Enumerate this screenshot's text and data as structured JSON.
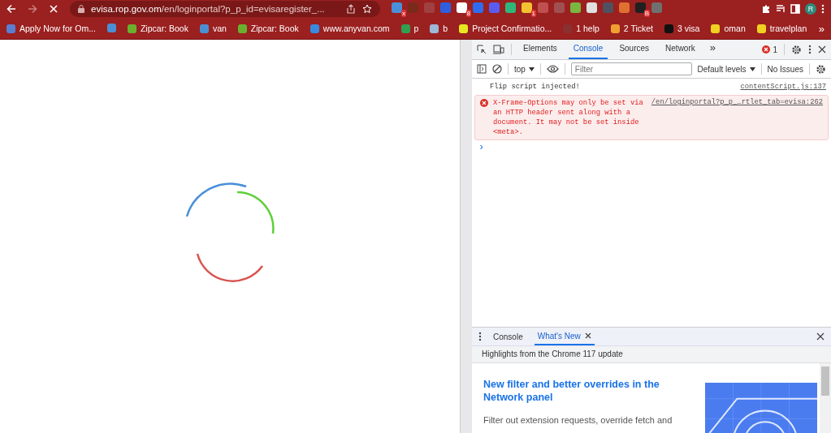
{
  "browser": {
    "url_host": "evisa.rop.gov.om",
    "url_path": "/en/loginportal?p_p_id=evisaregister_...",
    "loading": true,
    "extensions": [
      {
        "color": "#4a90d9",
        "badge": "x"
      },
      {
        "color": "#7a2a1a"
      },
      {
        "color": "#a04040"
      },
      {
        "color": "#2f5fe0"
      },
      {
        "color": "#ffffff",
        "badge": "8"
      },
      {
        "color": "#2f6cf0"
      },
      {
        "color": "#5a5cf0"
      },
      {
        "color": "#2fb67a"
      },
      {
        "color": "#f2c230",
        "badge": "1"
      },
      {
        "color": "#c05050"
      },
      {
        "color": "#a05050"
      },
      {
        "color": "#7ab640"
      },
      {
        "color": "#e0e0e0"
      },
      {
        "color": "#505060"
      },
      {
        "color": "#e07030"
      },
      {
        "color": "#202020",
        "badge": "B"
      },
      {
        "color": "#707070"
      }
    ],
    "avatar": "R",
    "bookmarks": [
      {
        "label": "Apply Now for Om...",
        "color": "#5b7fd0"
      },
      {
        "color": "#4a8fd4"
      },
      {
        "label": "Zipcar: Book",
        "color": "#6ab02e"
      },
      {
        "label": "van",
        "color": "#4a8fd4"
      },
      {
        "label": "Zipcar: Book",
        "color": "#6ab02e"
      },
      {
        "label": "www.anyvan.com",
        "color": "#3a8be0"
      },
      {
        "label": "p",
        "color": "#30a050"
      },
      {
        "label": "b",
        "color": "#a0b8d8"
      },
      {
        "label": "Project Confirmatio...",
        "color": "#e8e820"
      },
      {
        "label": "1 help",
        "color": "#8a3030"
      },
      {
        "label": "2 Ticket",
        "color": "#f0a030"
      },
      {
        "label": "3 visa",
        "color": "#111111"
      },
      {
        "label": "oman",
        "color": "#f0d020"
      },
      {
        "label": "travelplan",
        "color": "#f0d020"
      }
    ],
    "more_bookmarks": "»"
  },
  "devtools": {
    "tabs": [
      {
        "label": "Elements",
        "selected": false
      },
      {
        "label": "Console",
        "selected": true
      },
      {
        "label": "Sources",
        "selected": false
      },
      {
        "label": "Network",
        "selected": false
      }
    ],
    "more_tabs": "»",
    "error_count": "1",
    "context": "top",
    "filter": {
      "placeholder": "Filter"
    },
    "levels": "Default levels",
    "issues": "No Issues",
    "messages": [
      {
        "kind": "log",
        "text": "Flip script injected!",
        "source": "contentScript.js:137"
      },
      {
        "kind": "error",
        "text": "X-Frame-Options may only be set via an HTTP header sent along with a document. It may not be set inside <meta>.",
        "source": "/en/loginportal?p_p_…rtlet_tab=evisa:262"
      }
    ],
    "prompt": "›",
    "drawer": {
      "tabs": [
        {
          "label": "Console",
          "selected": false,
          "closable": false
        },
        {
          "label": "What's New",
          "selected": true,
          "closable": true
        }
      ],
      "subtitle": "Highlights from the Chrome 117 update",
      "heading": "New filter and better overrides in the Network panel",
      "paragraph": "Filter out extension requests, override fetch and"
    }
  }
}
